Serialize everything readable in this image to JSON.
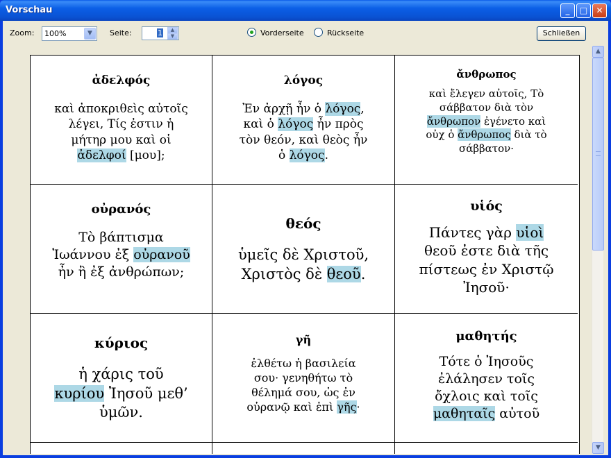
{
  "window": {
    "title": "Vorschau",
    "minimize_glyph": "_",
    "maximize_glyph": "□",
    "close_glyph": "✕"
  },
  "toolbar": {
    "zoom_label": "Zoom:",
    "zoom_value": "100%",
    "page_label": "Seite:",
    "page_value": "1",
    "front_label": "Vorderseite",
    "back_label": "Rückseite",
    "selected_side": "front",
    "close_label": "Schließen"
  },
  "cards": [
    {
      "word": "ἀδελφός",
      "verse": [
        [
          "καὶ ἀποκριθεὶς αὐτοῖς"
        ],
        [
          "λέγει, Τίς ἐστιν ἡ"
        ],
        [
          "μήτηρ μου καὶ οἱ"
        ],
        [
          {
            "t": "ἀδελφοί",
            "h": true
          },
          " [μου];"
        ]
      ]
    },
    {
      "word": "λόγος",
      "verse": [
        [
          "Ἐν ἀρχῇ ἦν ὁ ",
          {
            "t": "λόγος",
            "h": true
          },
          ","
        ],
        [
          "καὶ ὁ ",
          {
            "t": "λόγος",
            "h": true
          },
          " ἦν πρὸς"
        ],
        [
          "τὸν θεόν, καὶ θεὸς ἦν"
        ],
        [
          "ὁ ",
          {
            "t": "λόγος",
            "h": true
          },
          "."
        ]
      ]
    },
    {
      "word": "ἄνθρωπος",
      "verse": [
        [
          "καὶ ἔλεγεν αὐτοῖς, Τὸ"
        ],
        [
          "σάββατον διὰ τὸν"
        ],
        [
          {
            "t": "ἄνθρωπον",
            "h": true
          },
          " ἐγένετο καὶ"
        ],
        [
          "οὐχ ὁ ",
          {
            "t": "ἄνθρωπος",
            "h": true
          },
          " διὰ τὸ"
        ],
        [
          "σάββατον·"
        ]
      ]
    },
    {
      "word": "οὐρανός",
      "verse": [
        [
          "Τὸ βάπτισμα"
        ],
        [
          "Ἰωάννου ἐξ ",
          {
            "t": "οὐρανοῦ",
            "h": true
          }
        ],
        [
          "ἦν ἢ ἐξ ἀνθρώπων;"
        ]
      ]
    },
    {
      "word": "θεός",
      "verse": [
        [
          "ὑμεῖς δὲ Χριστοῦ,"
        ],
        [
          "Χριστὸς δὲ ",
          {
            "t": "θεοῦ",
            "h": true
          },
          "."
        ]
      ]
    },
    {
      "word": "υἱός",
      "verse": [
        [
          "Πάντες γὰρ ",
          {
            "t": "υἱοὶ",
            "h": true
          }
        ],
        [
          "θεοῦ ἐστε διὰ τῆς"
        ],
        [
          "πίστεως ἐν Χριστῷ"
        ],
        [
          "Ἰησοῦ·"
        ]
      ]
    },
    {
      "word": "κύριος",
      "verse": [
        [
          "ἡ χάρις τοῦ"
        ],
        [
          {
            "t": "κυρίου",
            "h": true
          },
          " Ἰησοῦ μεθ’"
        ],
        [
          "ὑμῶν."
        ]
      ]
    },
    {
      "word": "γῆ",
      "verse": [
        [
          "ἐλθέτω ἡ βασιλεία"
        ],
        [
          "σου· γενηθήτω τὸ"
        ],
        [
          "θέλημά σου, ὡς ἐν"
        ],
        [
          "οὐρανῷ καὶ ἐπὶ ",
          {
            "t": "γῆς",
            "h": true
          },
          "·"
        ]
      ]
    },
    {
      "word": "μαθητής",
      "verse": [
        [
          "Τότε ὁ Ἰησοῦς"
        ],
        [
          "ἐλάλησεν τοῖς"
        ],
        [
          "ὄχλοις καὶ τοῖς"
        ],
        [
          {
            "t": "μαθηταῖς",
            "h": true
          },
          " αὐτοῦ"
        ]
      ]
    }
  ],
  "colors": {
    "highlight": "#add8e6",
    "titlebar": "#0a5ce8",
    "face": "#ece9d8"
  }
}
